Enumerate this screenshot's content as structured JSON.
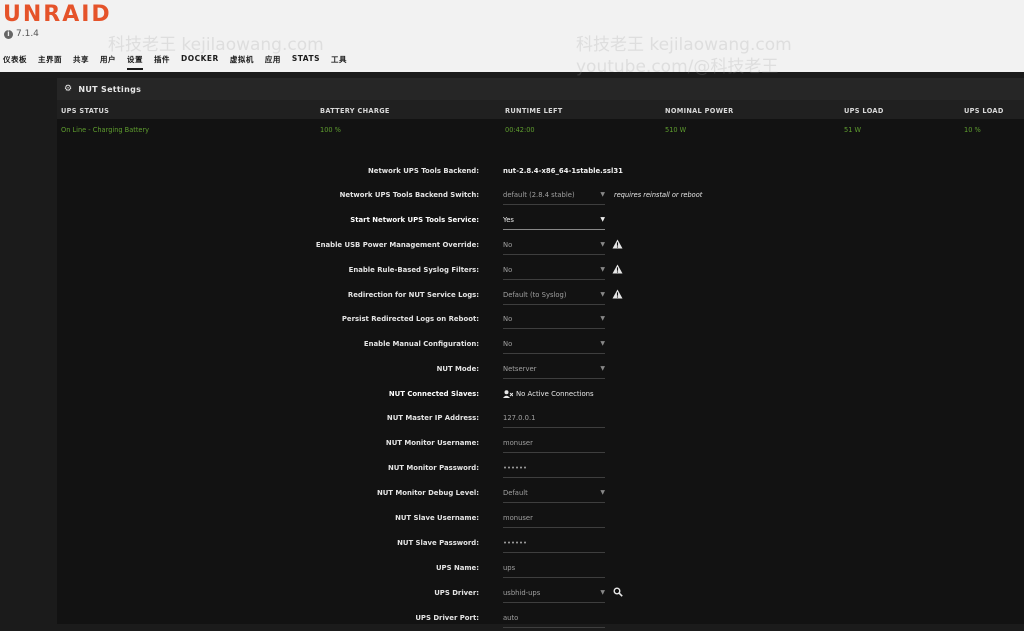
{
  "header": {
    "logo": "UNRAID",
    "version": "7.1.4",
    "nav": [
      "仪表板",
      "主界面",
      "共享",
      "用户",
      "设置",
      "插件",
      "DOCKER",
      "虚拟机",
      "应用",
      "STATS",
      "工具"
    ],
    "active_nav": "设置",
    "watermarks": [
      "科技老王 kejilaowang.com",
      "科技老王 kejilaowang.com",
      "youtube.com/@科技老王"
    ]
  },
  "panel": {
    "title": "NUT Settings",
    "status_headers": [
      "UPS STATUS",
      "BATTERY CHARGE",
      "RUNTIME LEFT",
      "NOMINAL POWER",
      "UPS LOAD",
      "UPS LOAD"
    ],
    "status_values": [
      "On Line - Charging Battery",
      "100 %",
      "00:42:00",
      "510 W",
      "51 W",
      "10 %"
    ]
  },
  "form": {
    "backend_label": "Network UPS Tools Backend:",
    "backend_value": "nut-2.8.4-x86_64-1stable.ssl31",
    "backend_switch_label": "Network UPS Tools Backend Switch:",
    "backend_switch_value": "default (2.8.4 stable)",
    "backend_switch_note": "requires reinstall or reboot",
    "start_service_label": "Start Network UPS Tools Service:",
    "start_service_value": "Yes",
    "usb_override_label": "Enable USB Power Management Override:",
    "usb_override_value": "No",
    "syslog_filters_label": "Enable Rule-Based Syslog Filters:",
    "syslog_filters_value": "No",
    "redirection_label": "Redirection for NUT Service Logs:",
    "redirection_value": "Default (to Syslog)",
    "persist_logs_label": "Persist Redirected Logs on Reboot:",
    "persist_logs_value": "No",
    "manual_config_label": "Enable Manual Configuration:",
    "manual_config_value": "No",
    "nut_mode_label": "NUT Mode:",
    "nut_mode_value": "Netserver",
    "connected_slaves_label": "NUT Connected Slaves:",
    "connected_slaves_value": "No Active Connections",
    "master_ip_label": "NUT Master IP Address:",
    "master_ip_value": "127.0.0.1",
    "monitor_user_label": "NUT Monitor Username:",
    "monitor_user_value": "monuser",
    "monitor_pass_label": "NUT Monitor Password:",
    "monitor_pass_value": "••••••",
    "debug_level_label": "NUT Monitor Debug Level:",
    "debug_level_value": "Default",
    "slave_user_label": "NUT Slave Username:",
    "slave_user_value": "monuser",
    "slave_pass_label": "NUT Slave Password:",
    "slave_pass_value": "••••••",
    "ups_name_label": "UPS Name:",
    "ups_name_value": "ups",
    "ups_driver_label": "UPS Driver:",
    "ups_driver_value": "usbhid-ups",
    "ups_port_label": "UPS Driver Port:",
    "ups_port_value": "auto"
  },
  "colors": {
    "logo": "#e5532a",
    "status_green": "#5f9e2f",
    "background": "#1b1b1b"
  },
  "icons": [
    "info-icon",
    "gear-icon",
    "warning-icon",
    "user-disconnected-icon",
    "search-icon",
    "chevron-down-icon"
  ]
}
